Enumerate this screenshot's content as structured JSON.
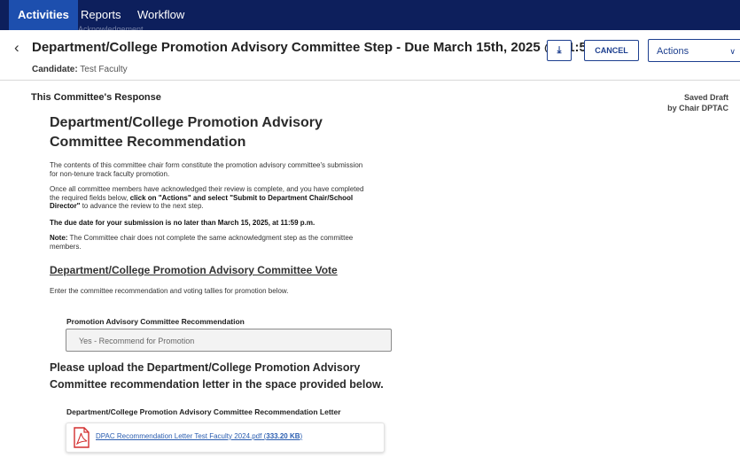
{
  "nav": {
    "tabs": [
      {
        "label": "Activities"
      },
      {
        "label": "Reports"
      },
      {
        "label": "Workflow"
      }
    ],
    "ghost_text": "Acknowledgement"
  },
  "header": {
    "title": "Department/College Promotion Advisory Committee Step - Due March 15th, 2025 @ 11:59 PM",
    "candidate_label": "Candidate:",
    "candidate_value": "Test Faculty",
    "cancel_label": "CANCEL",
    "actions_label": "Actions",
    "download_icon": "download-icon",
    "back_icon": "chevron-left-icon"
  },
  "main": {
    "response_heading": "This Committee's Response",
    "status_line1": "Saved Draft",
    "status_line2": "by Chair DPTAC",
    "form_title_line1": "Department/College Promotion Advisory",
    "form_title_line2": "Committee Recommendation",
    "para1": "The contents of this committee chair form constitute the promotion advisory committee's submission for non-tenure track faculty promotion.",
    "para2_a": "Once all committee members have acknowledged their review is complete, and you have completed the required fields below, ",
    "para2_b": "click on \"Actions\" and select \"Submit to Department Chair/School Director\"",
    "para2_c": " to advance the review to the next step.",
    "due_date": "The due date for your submission is no later than March 15, 2025, at 11:59 p.m.",
    "note_label": "Note:",
    "note_text": " The Committee chair does not complete the same acknowledgment step as the committee members.",
    "vote_heading": "Department/College Promotion Advisory Committee Vote",
    "vote_intro": "Enter the committee recommendation and voting tallies for promotion below.",
    "recommendation_label": "Promotion Advisory Committee Recommendation",
    "recommendation_value": "Yes - Recommend for Promotion",
    "upload_line1": "Please upload the Department/College Promotion Advisory",
    "upload_line2": "Committee recommendation letter in the space provided below.",
    "letter_label": "Department/College Promotion Advisory Committee Recommendation Letter",
    "file_name": "DPAC Recommendation Letter Test Faculty 2024.pdf",
    "file_size_open": " (",
    "file_size": "333.20 KB",
    "file_size_close": ")",
    "file_icon": "pdf-file-icon"
  },
  "colors": {
    "nav_bg": "#0d1f5c",
    "nav_active": "#1d4fae",
    "accent": "#1d3f8f",
    "pdf_red": "#d32f2f",
    "link": "#2a5db0"
  }
}
